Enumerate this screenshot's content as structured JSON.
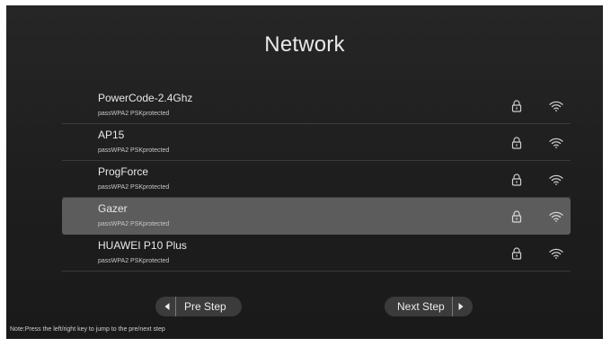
{
  "screen": {
    "title": "Network"
  },
  "networks": [
    {
      "ssid": "PowerCode-2.4Ghz",
      "security": "passWPA2 PSKprotected",
      "locked": true,
      "selected": false
    },
    {
      "ssid": "AP15",
      "security": "passWPA2 PSKprotected",
      "locked": true,
      "selected": false
    },
    {
      "ssid": "ProgForce",
      "security": "passWPA2 PSKprotected",
      "locked": true,
      "selected": false
    },
    {
      "ssid": "Gazer",
      "security": "passWPA2 PSKprotected",
      "locked": true,
      "selected": true
    },
    {
      "ssid": "HUAWEI P10 Plus",
      "security": "passWPA2 PSKprotected",
      "locked": true,
      "selected": false
    }
  ],
  "buttons": {
    "prev_label": "Pre Step",
    "next_label": "Next Step"
  },
  "note": "Note:Press the left/right key to jump to the pre/next step",
  "icons": {
    "lock": "lock-icon",
    "wifi": "wifi-icon",
    "prev_arrow": "arrow-left-icon",
    "next_arrow": "arrow-right-icon"
  },
  "colors": {
    "panel_background": "#1d1d1d",
    "selected_row": "#5c5c5c",
    "text": "#e8e8e8"
  }
}
